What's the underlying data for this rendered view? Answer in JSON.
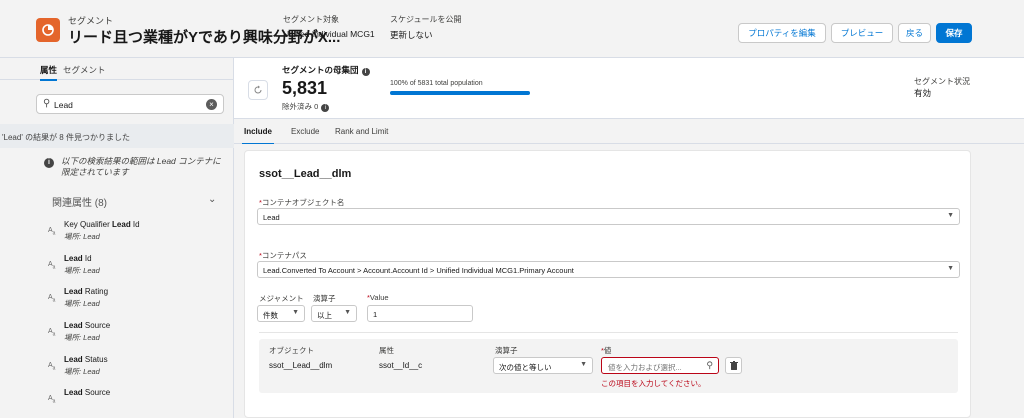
{
  "header": {
    "kicker": "セグメント",
    "title": "リード且つ業種がYであり興味分野がX...",
    "fields": [
      {
        "label": "セグメント対象",
        "value": "Unified Individual MCG1"
      },
      {
        "label": "スケジュールを公開",
        "value": "更新しない"
      }
    ],
    "buttons": {
      "edit_properties": "プロパティを編集",
      "preview": "プレビュー",
      "back": "戻る",
      "save": "保存"
    },
    "icon": "segment-icon",
    "accent_color": "#e4652b"
  },
  "left_panel": {
    "tabs": [
      "属性",
      "セグメント"
    ],
    "active_tab": "属性",
    "search": {
      "value": "Lead"
    },
    "results_text": "'Lead' の結果が 8 件見つかりました",
    "notice": "以下の検索結果の範囲は Lead コンテナに限定されています",
    "related_header": "関連属性 (8)",
    "attributes": [
      {
        "prefix": "Key Qualifier ",
        "bold": "Lead",
        "suffix": " Id",
        "location": "場所: Lead"
      },
      {
        "prefix": "",
        "bold": "Lead",
        "suffix": " Id",
        "location": "場所: Lead"
      },
      {
        "prefix": "",
        "bold": "Lead",
        "suffix": " Rating",
        "location": "場所: Lead"
      },
      {
        "prefix": "",
        "bold": "Lead",
        "suffix": " Source",
        "location": "場所: Lead"
      },
      {
        "prefix": "",
        "bold": "Lead",
        "suffix": " Status",
        "location": "場所: Lead"
      },
      {
        "prefix": "",
        "bold": "Lead",
        "suffix": " Source",
        "location": ""
      }
    ]
  },
  "population": {
    "title": "セグメントの母集団",
    "count": "5,831",
    "excluded": "除外済み 0",
    "percent_label": "100% of 5831 total population",
    "percent_fill": 100,
    "status_label": "セグメント状況",
    "status_value": "有効"
  },
  "tabs": [
    "Include",
    "Exclude",
    "Rank and Limit"
  ],
  "active_tab": "Include",
  "editor": {
    "title": "ssot__Lead__dlm",
    "container_object_label": "コンテナオブジェクト名",
    "container_object_value": "Lead",
    "container_path_label": "コンテナパス",
    "container_path_value": "Lead.Converted To Account > Account.Account Id > Unified Individual MCG1.Primary Account",
    "measurement_label": "メジャメント",
    "measurement_value": "件数",
    "operator_label": "演算子",
    "operator_value": "以上",
    "value_label": "Value",
    "value_value": "1",
    "filter": {
      "object_header": "オブジェクト",
      "attribute_header": "属性",
      "operator_header": "演算子",
      "value_header": "値",
      "object_value": "ssot__Lead__dlm",
      "attribute_value": "ssot__Id__c",
      "operator_value": "次の値と等しい",
      "value_placeholder": "値を入力および選択...",
      "error": "この項目を入力してください。"
    }
  }
}
